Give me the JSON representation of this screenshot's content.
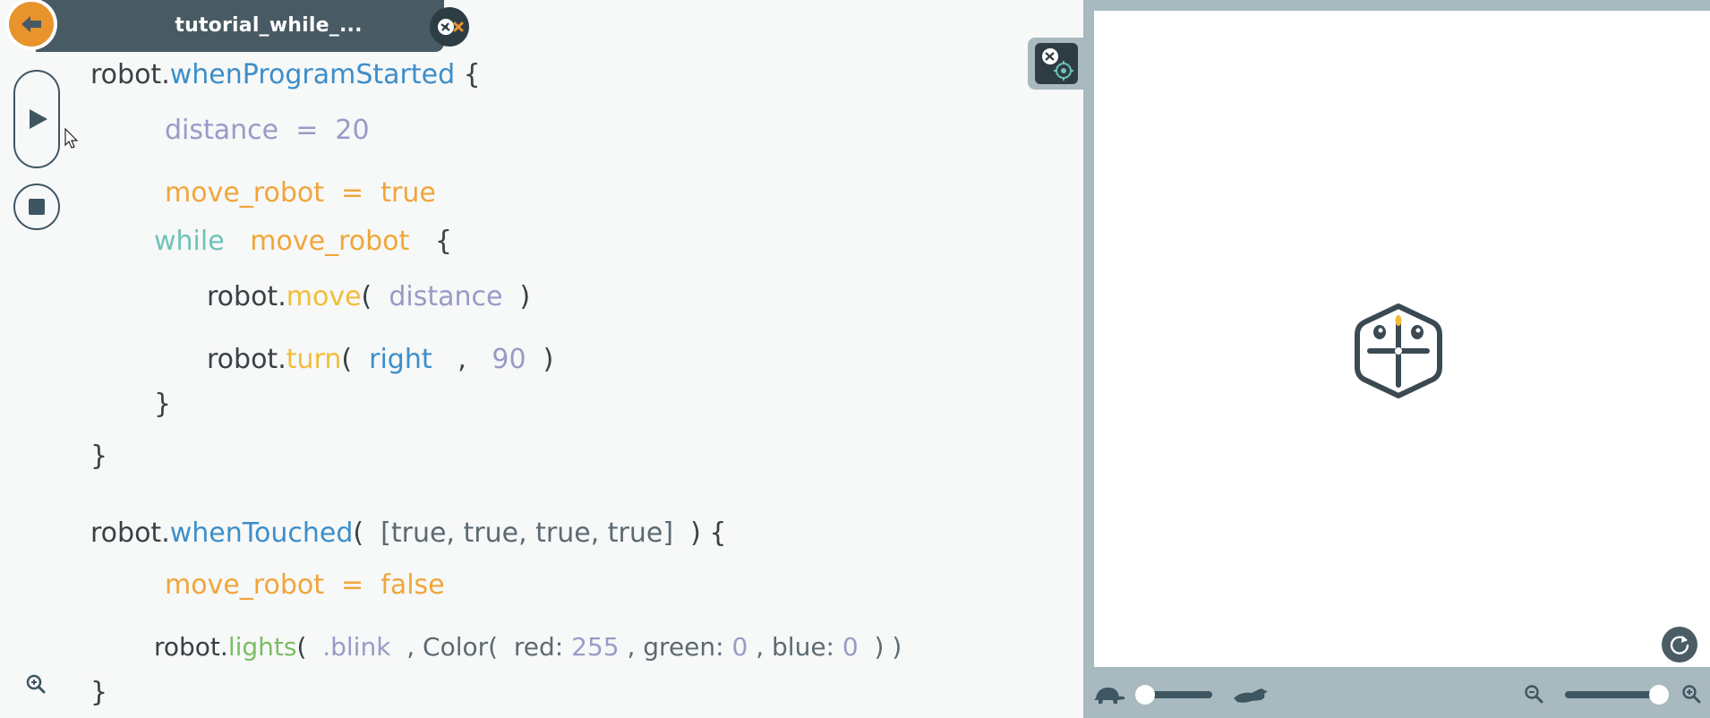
{
  "tab": {
    "title": "tutorial_while_..."
  },
  "icons": {
    "back": "arrow-left-icon",
    "close": "robot-close-icon",
    "run": "play-icon",
    "stop": "stop-icon",
    "cursor": "mouse-pointer-icon",
    "editor_zoom": "zoom-in-icon",
    "panel_toggle": "robot-gear-icon",
    "reset": "refresh-icon",
    "speed_slow": "turtle-icon",
    "speed_fast": "rabbit-icon",
    "zoom_out": "zoom-out-icon",
    "zoom_in": "zoom-in-icon",
    "robot": "robot-icon"
  },
  "colors": {
    "accent_orange": "#e8932c",
    "tab_bg": "#485a63",
    "panel_bg": "#a8b9bf",
    "event_blue": "#3d8ec9",
    "variable_orange": "#f0a63a",
    "number_purple": "#9b9ac7",
    "while_teal": "#6ec4b8",
    "function_yellow": "#f1be3a",
    "lights_green": "#7abe63"
  },
  "code": {
    "l1": {
      "obj": "robot.",
      "event": "whenProgramStarted",
      "brace": " {"
    },
    "l2": {
      "var": "distance",
      "op": "  =  ",
      "val": "20"
    },
    "l3": {
      "var": "move_robot",
      "op": "  =  ",
      "val": "true"
    },
    "l4": {
      "kw": "while",
      "var": "move_robot",
      "brace": "{"
    },
    "l5": {
      "obj": "robot.",
      "fn": "move",
      "open": "(",
      "arg": "distance",
      "close": ")"
    },
    "l6": {
      "obj": "robot.",
      "fn": "turn",
      "open": "(",
      "arg1": "right",
      "sep": ",",
      "arg2": "90",
      "close": ")"
    },
    "l7": {
      "brace": "}"
    },
    "l8": {
      "brace": "}"
    },
    "l9": {
      "obj": "robot.",
      "event": "whenTouched",
      "open": "(",
      "arg": "[true, true, true, true]",
      "close": ") {"
    },
    "l10": {
      "var": "move_robot",
      "op": "  =  ",
      "val": "false"
    },
    "l11": {
      "obj": "robot.",
      "fn": "lights",
      "open": "(",
      "arg": ".blink",
      "sep1": ", Color(",
      "red_label": "red:",
      "red_val": "255",
      "green_label": ", green:",
      "green_val": "0",
      "blue_label": ", blue:",
      "blue_val": "0",
      "close": ") )"
    },
    "l12": {
      "brace": "}"
    }
  },
  "stage": {
    "speed_level": 0.0,
    "zoom_level": 1.0
  }
}
